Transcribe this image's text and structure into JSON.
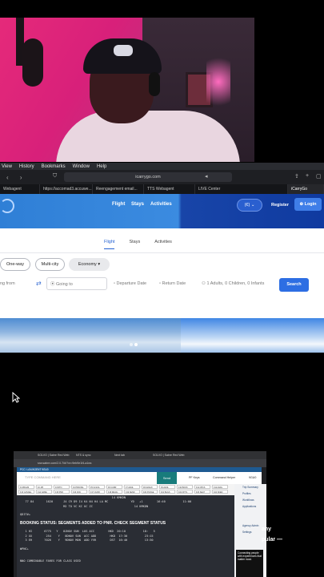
{
  "menubar": {
    "items": [
      "View",
      "History",
      "Bookmarks",
      "Window",
      "Help"
    ]
  },
  "browser": {
    "url": "icarrygo.com",
    "tabs": [
      "Webagent",
      "https://accomad3.accuwe...",
      "Reengagement email...",
      "TTS Webagent",
      "LIVE Center",
      "iCarryGo"
    ]
  },
  "site": {
    "nav": {
      "flight": "Flight",
      "stays": "Stays",
      "activities": "Activities"
    },
    "currency": "(€)",
    "register": "Register",
    "login": "Login",
    "tabs": {
      "flight": "Flight",
      "stays": "Stays",
      "activities": "Activities"
    },
    "trip_type": {
      "one_way": "One-way",
      "multi_city": "Multi-city",
      "cabin": "Economy"
    },
    "fields": {
      "from_placeholder": "ng from",
      "to_placeholder": "Going to",
      "departure": "Departure Date",
      "return": "Return Date",
      "travellers": "1 Adults, 0 Children, 0 Infants"
    },
    "search_button": "Search"
  },
  "inner": {
    "tabs": [
      "SOLVO | Sabre Red Web",
      "NTS & sync",
      "Next tab",
      "SOLVO | Sabre Red Web"
    ],
    "url": "srw.sabre.com/2.0.7/#/?xr=9eb9e1f4-a1ea",
    "header": "PCC: LAX/AGENT 9GU0",
    "command_placeholder": "TYPE COMMAND HERE",
    "send": "Send",
    "options": [
      "PF Keys",
      "Command Helper",
      "9GU0"
    ],
    "keys": [
      "F1 BKG/M",
      "F2 J/B",
      "F3 RTN",
      "F4 PRICING",
      "F5 CLS/CL",
      "F6 CURR",
      "F7 AVAIL",
      "F8 AVAIL/F",
      "F9 AVAIL",
      "F10 BOOK",
      "F11 QPCS",
      "F12 AVAIL",
      "F13 CANCEL",
      "F14 NAME",
      "F15 PNR",
      "F16 ONC",
      "F17 CURR",
      "F18 REVAL",
      "F19 SEND",
      "F20 PURGE",
      "F21 BAGS",
      "F22 FP/TL",
      "F23 SEAT",
      "F24 SKED"
    ],
    "terminal_lines": [
      "                                                     14 KMKDN",
      "   77 84       1620      J4 C9 D9 I4 K4 N4 H4 LA MC             YD   +1        16:40          11:00",
      "                         M2 TO VC KC UC ZC                        14 KMKDN",
      "",
      "QDIT#+",
      "",
      "",
      "   1 HI       6775   Y   8JNOV SUN  LOS ACC        HKD  20:10          18:   5",
      "   2 XX        254    Y   8DNOV SUN  ACC ADD        HKD  17:30          23:15",
      "   3 EH       7026    Y   9DNOV MON  ADD YVR        DST  16:40          13:30",
      "",
      "WPNC+",
      "",
      "",
      "NNO COMBINABLE FARES FOR CLASS USED"
    ],
    "booking_status": "BOOKING STATUS: SEGMENTS ADDED TO PNR. CHECK SEGMENT STATUS",
    "sidebar": [
      "Trip Summary",
      "Profiles",
      "Workflows",
      "Applications",
      "Agency Admin",
      "Settings"
    ],
    "ad_text": "Connecting people with experiences that matter most."
  },
  "overlay": {
    "line1": "any",
    "line2": "pular —"
  }
}
